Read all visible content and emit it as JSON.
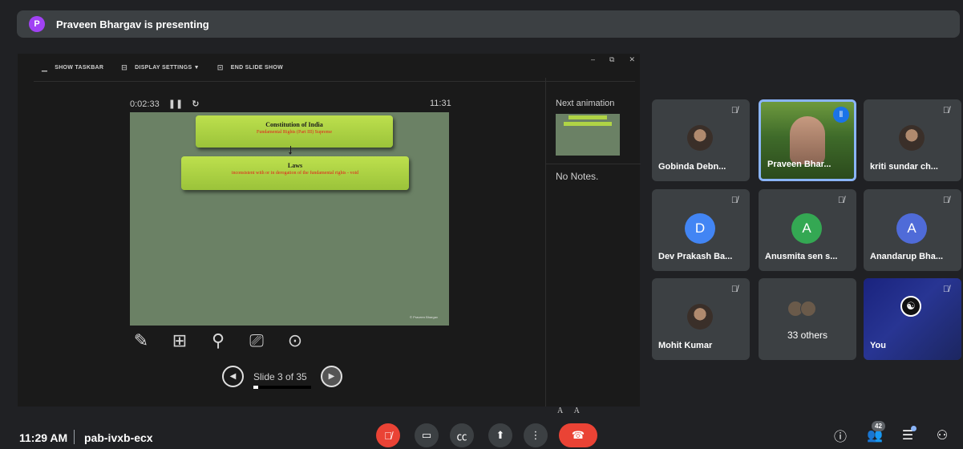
{
  "presenter_bar": {
    "initial": "P",
    "text": "Praveen Bhargav is presenting"
  },
  "presenter_view": {
    "toolbar": [
      {
        "icon": "taskbar-icon",
        "label": "SHOW TASKBAR"
      },
      {
        "icon": "display-settings-icon",
        "label": "DISPLAY SETTINGS ▼"
      },
      {
        "icon": "end-show-icon",
        "label": "END SLIDE SHOW"
      }
    ],
    "elapsed": "0:02:33",
    "clock": "11:31",
    "slide": {
      "box1_title": "Constitution of India",
      "box1_sub": "Fundamental Rights (Part III) Supreme",
      "box2_title": "Laws",
      "box2_sub": "inconsistent with or in derogation of the fundamental rights - void",
      "copyright": "© Praveen Bhargav"
    },
    "slide_counter": "Slide 3 of 35",
    "progress": 0.086,
    "next_label": "Next animation",
    "notes": "No Notes.",
    "font_controls": "A A"
  },
  "participants": [
    {
      "name": "Gobinda Debn...",
      "type": "photo",
      "muted": true
    },
    {
      "name": "Praveen Bhar...",
      "type": "speaking",
      "muted": false
    },
    {
      "name": "kriti sundar ch...",
      "type": "photo",
      "muted": true
    },
    {
      "name": "Dev Prakash Ba...",
      "type": "initial",
      "initial": "D",
      "color": "#4285f4",
      "muted": true
    },
    {
      "name": "Anusmita sen s...",
      "type": "initial",
      "initial": "A",
      "color": "#34a853",
      "muted": true
    },
    {
      "name": "Anandarup Bha...",
      "type": "initial",
      "initial": "A",
      "color": "#4f6bd8",
      "muted": true
    },
    {
      "name": "Mohit Kumar",
      "type": "photo",
      "muted": true
    },
    {
      "name": "33 others",
      "type": "others",
      "muted": false
    },
    {
      "name": "You",
      "type": "self",
      "muted": true
    }
  ],
  "bottom": {
    "time": "11:29 AM",
    "meeting_code": "pab-ivxb-ecx",
    "people_count": "42"
  },
  "colors": {
    "accent": "#8ab4f8",
    "danger": "#ea4335",
    "tile": "#3c4043",
    "bg": "#202124"
  }
}
